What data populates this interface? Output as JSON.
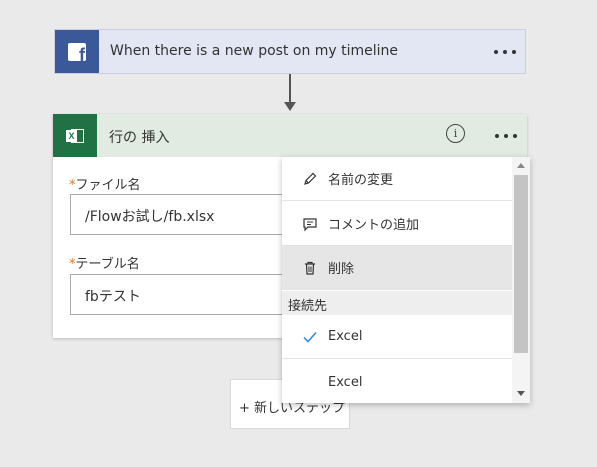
{
  "trigger": {
    "title": "When there is a new post on my timeline",
    "icon": "facebook-icon",
    "color": "#3b5998"
  },
  "action": {
    "title": "行の 挿入",
    "icon": "excel-icon",
    "color": "#207245",
    "fields": [
      {
        "required_mark": "*",
        "label": "ファイル名",
        "value": "/Flowお試し/fb.xlsx"
      },
      {
        "required_mark": "*",
        "label": "テーブル名",
        "value": "fbテスト"
      }
    ]
  },
  "new_step": {
    "label": "+ 新しいステップ"
  },
  "menu": {
    "rename": {
      "label": "名前の変更",
      "icon": "pencil-icon"
    },
    "add_comment": {
      "label": "コメントの追加",
      "icon": "comment-icon"
    },
    "delete": {
      "label": "削除",
      "icon": "trash-icon"
    },
    "section_label": "接続先",
    "connections": [
      {
        "label": "Excel",
        "selected": true
      },
      {
        "label": "Excel",
        "selected": false
      }
    ]
  }
}
